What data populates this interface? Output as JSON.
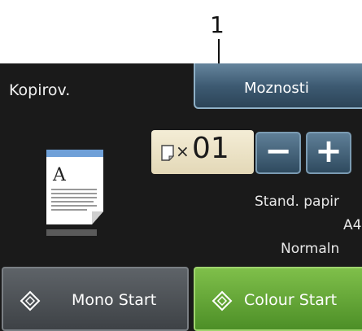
{
  "callout": {
    "number": "1"
  },
  "screen": {
    "title": "Kopirov.",
    "options_label": "Moznosti",
    "copies": {
      "multiplier": "×",
      "count": "01"
    },
    "minus_label": "−",
    "plus_label": "+",
    "settings": [
      "Stand. papir",
      "A4",
      "Normaln"
    ],
    "mono_start_label": "Mono Start",
    "colour_start_label": "Colour Start"
  },
  "colors": {
    "screen_bg": "#1a1a1a",
    "colour_start": "#5fa532",
    "button_blue": "#3d5a72",
    "copies_bg": "#ece2c4"
  },
  "icons": [
    "document-preview-icon",
    "page-icon",
    "diamond-start-icon"
  ]
}
